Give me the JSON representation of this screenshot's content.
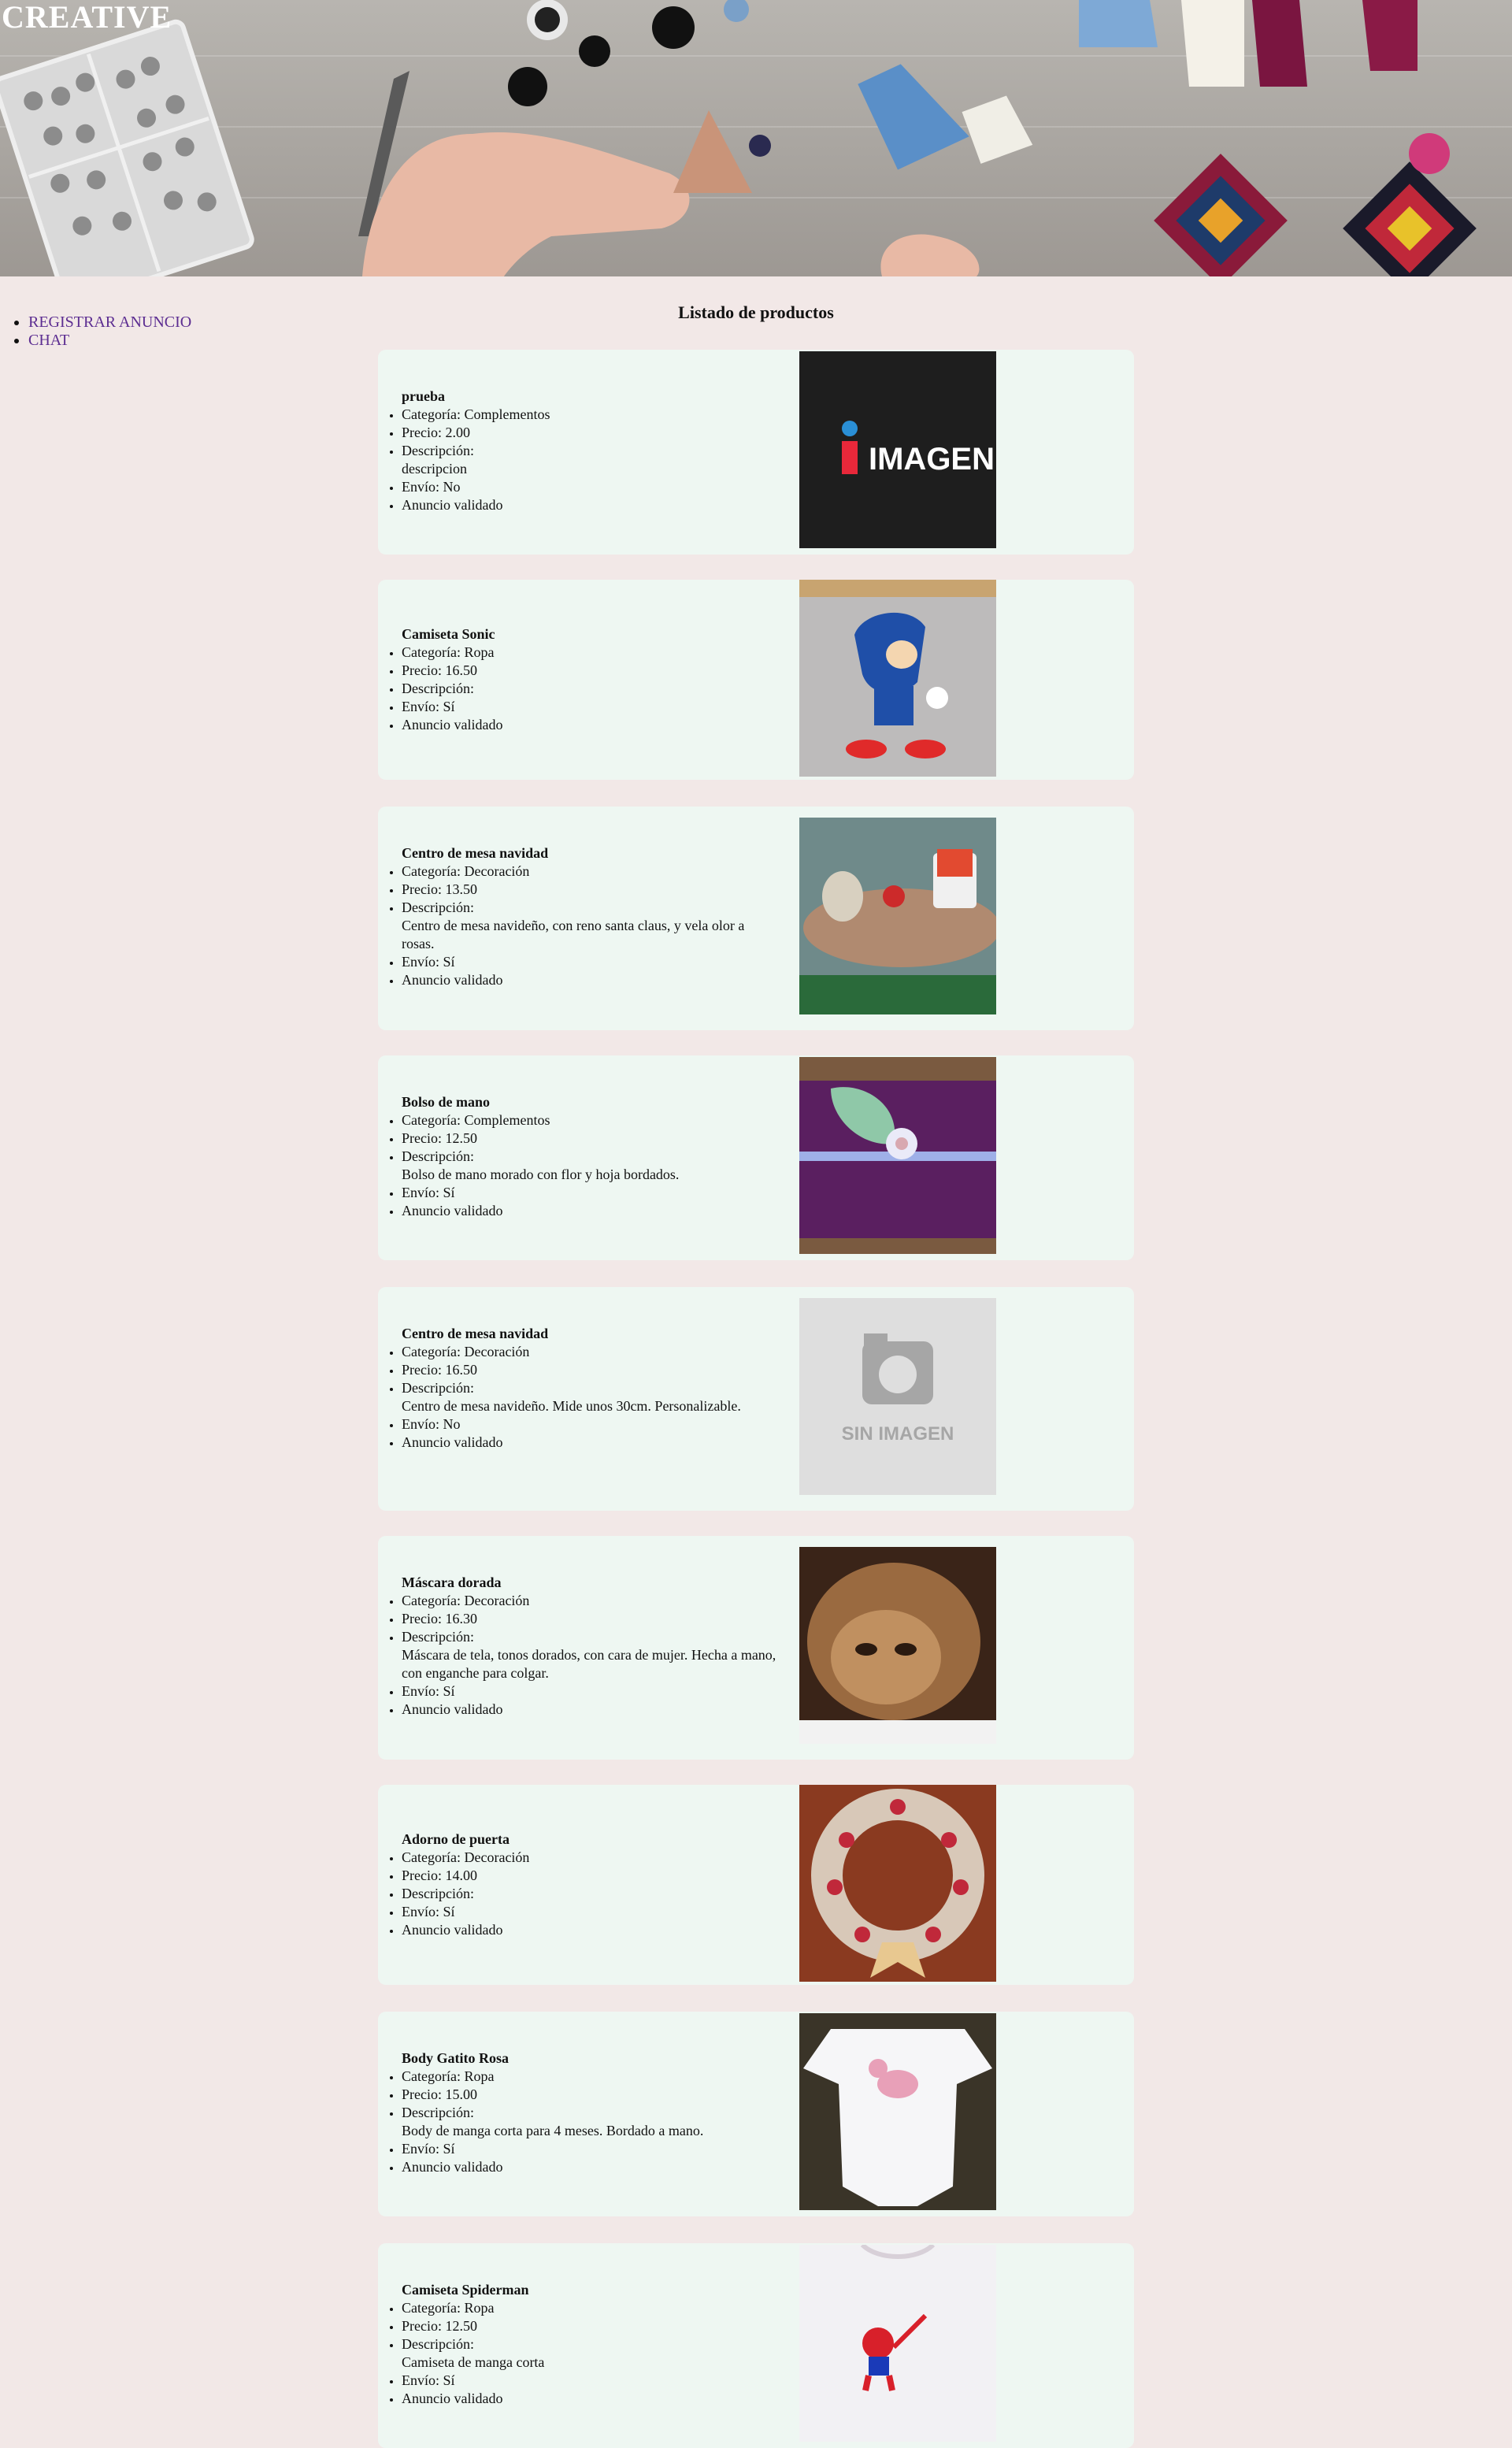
{
  "header": {
    "title": "CREATIVE"
  },
  "nav": {
    "items": [
      "REGISTRAR ANUNCIO",
      "CHAT"
    ]
  },
  "main": {
    "title": "Listado de productos",
    "labels": {
      "category": "Categoría: ",
      "price": "Precio: ",
      "description": "Descripción:",
      "shipping": "Envío: ",
      "validated": "Anuncio validado"
    },
    "products": [
      {
        "name": "prueba",
        "category": "Complementos",
        "price": "2.00",
        "description": "descripcion",
        "shipping": "No",
        "image": "imagen-placeholder"
      },
      {
        "name": "Camiseta Sonic",
        "category": "Ropa",
        "price": "16.50",
        "description": "",
        "shipping": "Sí",
        "image": "sonic-shirt"
      },
      {
        "name": "Centro de mesa navidad",
        "category": "Decoración",
        "price": "13.50",
        "description": "Centro de mesa navideño, con reno santa claus, y vela olor a rosas.",
        "shipping": "Sí",
        "image": "xmas-centerpiece-1"
      },
      {
        "name": "Bolso de mano",
        "category": "Complementos",
        "price": "12.50",
        "description": "Bolso de mano morado con flor y hoja bordados.",
        "shipping": "Sí",
        "image": "purple-bag"
      },
      {
        "name": "Centro de mesa navidad",
        "category": "Decoración",
        "price": "16.50",
        "description": "Centro de mesa navideño. Mide unos 30cm. Personalizable.",
        "shipping": "No",
        "image": "sin-imagen"
      },
      {
        "name": "Máscara dorada",
        "category": "Decoración",
        "price": "16.30",
        "description": "Máscara de tela, tonos dorados, con cara de mujer. Hecha a mano, con enganche para colgar.",
        "shipping": "Sí",
        "image": "gold-mask"
      },
      {
        "name": "Adorno de puerta",
        "category": "Decoración",
        "price": "14.00",
        "description": "",
        "shipping": "Sí",
        "image": "door-wreath"
      },
      {
        "name": "Body Gatito Rosa",
        "category": "Ropa",
        "price": "15.00",
        "description": "Body de manga corta para 4 meses. Bordado a mano.",
        "shipping": "Sí",
        "image": "baby-body-cat"
      },
      {
        "name": "Camiseta Spiderman",
        "category": "Ropa",
        "price": "12.50",
        "description": "Camiseta de manga corta",
        "shipping": "Sí",
        "image": "spiderman-shirt"
      }
    ],
    "placeholder_texts": {
      "imagen": "IMAGEN",
      "sin_imagen": "SIN IMAGEN"
    }
  },
  "colors": {
    "page_bg": "#f2e8e7",
    "card_bg": "#eef7f2",
    "link": "#5c2d91",
    "banner_title": "#ffffff"
  }
}
